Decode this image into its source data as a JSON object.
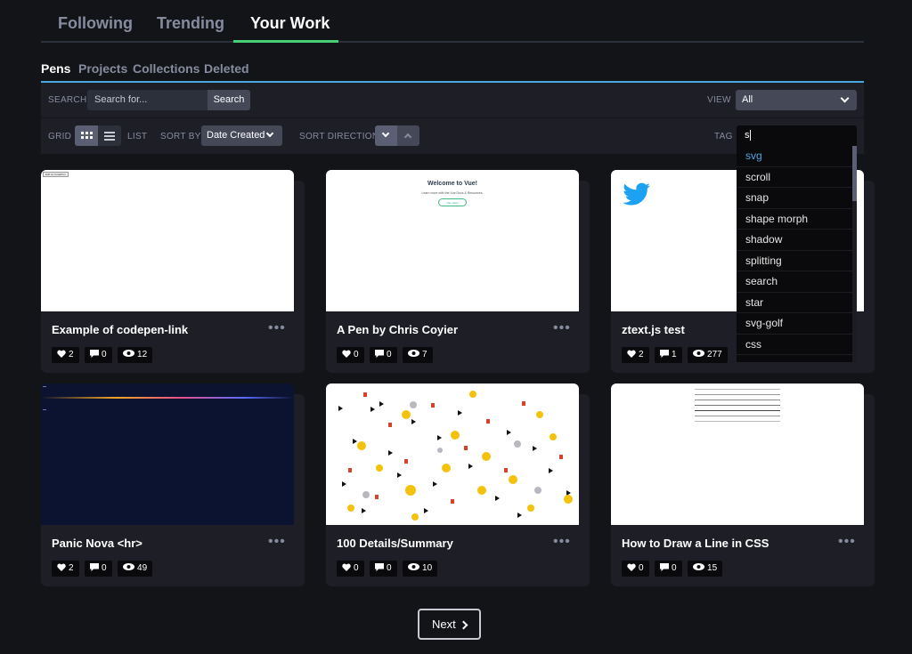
{
  "top_tabs": [
    "Following",
    "Trending",
    "Your Work"
  ],
  "sub_tabs": [
    "Pens",
    "Projects",
    "Collections",
    "Deleted"
  ],
  "filters": {
    "search_label": "SEARCH",
    "search_placeholder": "Search for...",
    "search_button": "Search",
    "view_label": "VIEW",
    "view_value": "All",
    "grid_label": "GRID",
    "list_label": "LIST",
    "sort_by_label": "SORT BY",
    "sort_by_value": "Date Created",
    "sort_direction_label": "SORT DIRECTION",
    "tag_label": "TAG",
    "tag_value": "s"
  },
  "tag_suggestions": [
    "svg",
    "scroll",
    "snap",
    "shape morph",
    "shadow",
    "splitting",
    "search",
    "star",
    "svg-golf",
    "css"
  ],
  "cards": [
    {
      "title": "Example of codepen-link",
      "likes": "2",
      "comments": "0",
      "views": "12",
      "preview_text": "Edit on CodePen"
    },
    {
      "title": "A Pen by Chris Coyier",
      "likes": "0",
      "comments": "0",
      "views": "7",
      "preview_text": "Welcome to Vue!",
      "preview_sub": "Learn more with the Vue Docs & Resources.",
      "preview_btn": "Say Hello"
    },
    {
      "title": "ztext.js test",
      "likes": "2",
      "comments": "1",
      "views": "277"
    },
    {
      "title": "Panic Nova <hr>",
      "likes": "2",
      "comments": "0",
      "views": "49"
    },
    {
      "title": "100 Details/Summary",
      "likes": "0",
      "comments": "0",
      "views": "10"
    },
    {
      "title": "How to Draw a Line in CSS",
      "likes": "0",
      "comments": "0",
      "views": "15"
    }
  ],
  "pagination": {
    "next_label": "Next"
  },
  "colors": {
    "accent_green": "#47cf73",
    "accent_blue": "#4aa8e0",
    "twitter_blue": "#1da1f2"
  }
}
